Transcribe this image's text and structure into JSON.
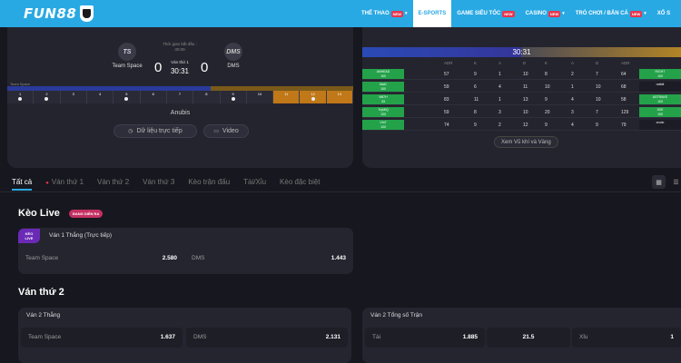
{
  "brand": {
    "logo": "FUN88"
  },
  "nav": [
    {
      "label": "THỂ THAO",
      "badge": "NEW",
      "chevron": true,
      "active": false
    },
    {
      "label": "E-SPORTS",
      "badge": "",
      "chevron": false,
      "active": true
    },
    {
      "label": "GAME SIÊU TỐC",
      "badge": "NEW",
      "chevron": false,
      "active": false
    },
    {
      "label": "CASINO",
      "badge": "NEW",
      "chevron": true,
      "active": false
    },
    {
      "label": "TRÒ CHƠI / BẮN CÁ",
      "badge": "NEW",
      "chevron": true,
      "active": false
    },
    {
      "label": "XỔ S",
      "badge": "",
      "chevron": false,
      "active": false
    }
  ],
  "match": {
    "team_a": {
      "name": "Team Space",
      "logo_text": "TS",
      "score": "0"
    },
    "team_b": {
      "name": "DMS",
      "logo_text": "DMS",
      "score": "0"
    },
    "time_label": "Thời gian bắt đầu :",
    "time_value": "30:09",
    "round_label": "Ván thứ 1",
    "clock": "30:31",
    "rounds_label": "Team Space",
    "map": "Anubis",
    "data_button": "Dữ liệu trực tiếp",
    "video_button": "Video",
    "round_numbers": [
      "1",
      "2",
      "3",
      "4",
      "5",
      "6",
      "7",
      "8",
      "9",
      "10",
      "11",
      "12",
      "13"
    ],
    "rounds_won": [
      1,
      1,
      0,
      0,
      1,
      0,
      0,
      0,
      1,
      0,
      0,
      1,
      0
    ]
  },
  "stats": {
    "clock": "30:31",
    "headers": [
      "ADR",
      "K",
      "A",
      "D",
      "K",
      "A",
      "D",
      "ADR"
    ],
    "rows": [
      {
        "left_name": "ANHEAD",
        "left_sub": "100",
        "values": [
          "57",
          "9",
          "1",
          "10",
          "8",
          "2",
          "7",
          "64"
        ],
        "right_name": "RIGHT",
        "right_sub": "100",
        "right_green": true
      },
      {
        "left_name": "Mat1",
        "left_sub": "100",
        "values": [
          "59",
          "6",
          "4",
          "11",
          "10",
          "1",
          "10",
          "68"
        ],
        "right_name": "rabbit",
        "right_sub": "",
        "right_green": false
      },
      {
        "left_name": "Wil7H",
        "left_sub": "33",
        "values": [
          "83",
          "11",
          "1",
          "13",
          "9",
          "4",
          "10",
          "58"
        ],
        "right_name": "ASTRAKE",
        "right_sub": "100",
        "right_green": true
      },
      {
        "left_name": "TryMiQ",
        "left_sub": "100",
        "values": [
          "59",
          "8",
          "3",
          "10",
          "20",
          "3",
          "7",
          "129"
        ],
        "right_name": "SZE",
        "right_sub": "100",
        "right_green": true
      },
      {
        "left_name": "Vtn7",
        "left_sub": "100",
        "values": [
          "74",
          "9",
          "2",
          "12",
          "9",
          "4",
          "9",
          "79"
        ],
        "right_name": "crodo",
        "right_sub": "",
        "right_green": false
      }
    ],
    "weapons_button": "Xem Vũ khí và Vàng"
  },
  "tabs": [
    {
      "label": "Tất cả",
      "active": true,
      "live": false
    },
    {
      "label": "Ván thứ 1",
      "active": false,
      "live": true
    },
    {
      "label": "Ván thứ 2",
      "active": false,
      "live": false
    },
    {
      "label": "Ván thứ 3",
      "active": false,
      "live": false
    },
    {
      "label": "Kèo trận đấu",
      "active": false,
      "live": false
    },
    {
      "label": "Tài/Xỉu",
      "active": false,
      "live": false
    },
    {
      "label": "Kèo đặc biệt",
      "active": false,
      "live": false
    }
  ],
  "keo_live": {
    "title": "Kèo Live",
    "status_pill": "ĐANG DIỄN RA",
    "card": {
      "tag_top": "KÈO",
      "tag_bottom": "LIVE",
      "title": "Ván 1 Thắng (Trực tiếp)",
      "left_team": "Team Space",
      "left_odd": "2.580",
      "right_team": "DMS",
      "right_odd": "1.443"
    }
  },
  "van_2": {
    "title": "Ván thứ 2",
    "win_card": {
      "title": "Ván 2 Thắng",
      "left_team": "Team Space",
      "left_odd": "1.637",
      "right_team": "DMS",
      "right_odd": "2.131"
    },
    "total_card": {
      "title": "Ván 2 Tổng số Trận",
      "over_label": "Tài",
      "over_odd": "1.885",
      "line": "21.5",
      "under_label": "Xỉu",
      "under_odd": "1"
    }
  },
  "colors": {
    "brand": "#29a9e3",
    "live": "#e8354d",
    "green": "#23a24a",
    "purple": "#6a2ab5"
  }
}
